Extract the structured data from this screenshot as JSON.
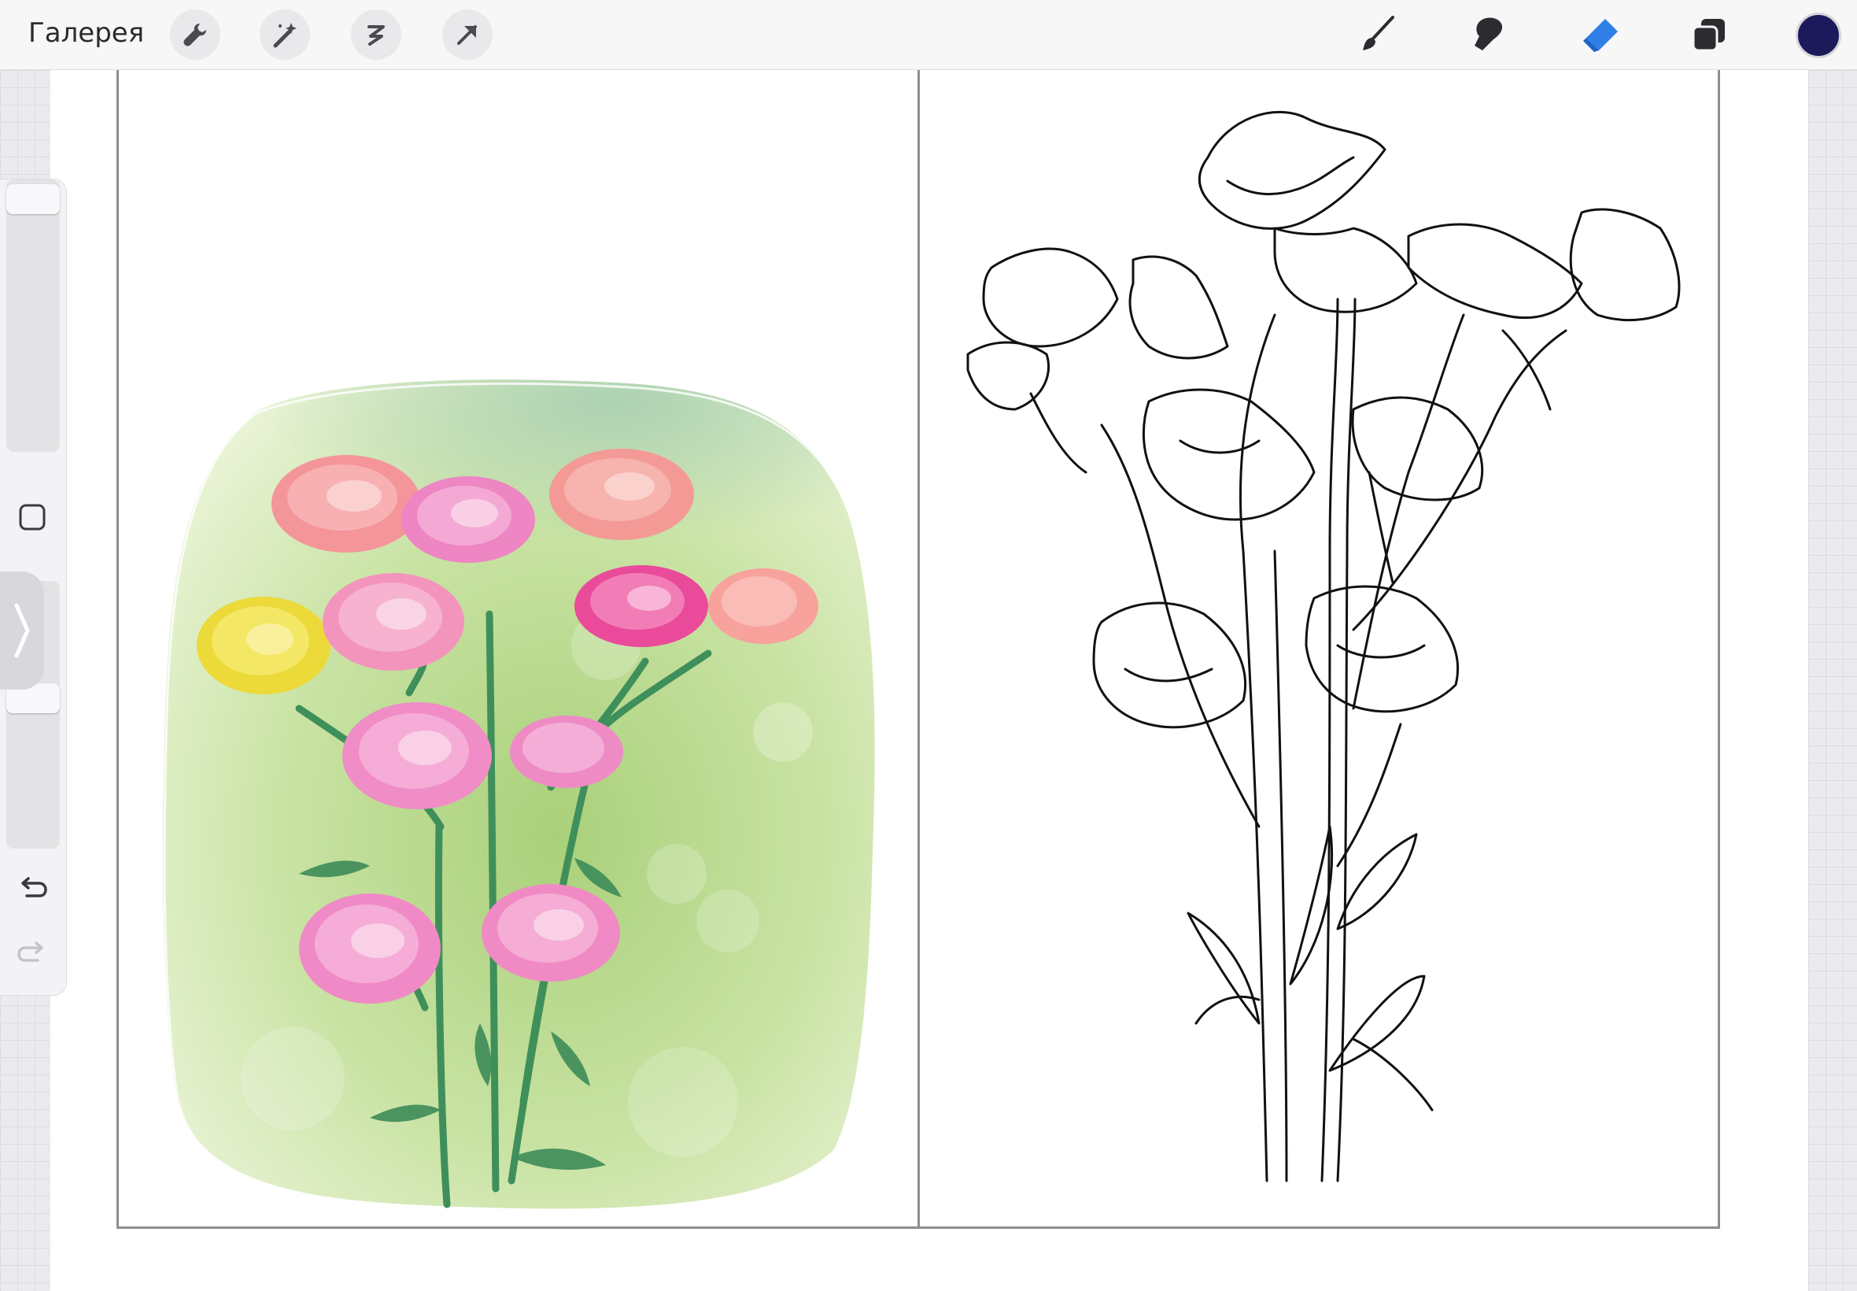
{
  "toolbar": {
    "gallery_label": "Галерея",
    "left_tools": [
      {
        "name": "wrench-icon"
      },
      {
        "name": "magic-wand-icon"
      },
      {
        "name": "selection-icon"
      },
      {
        "name": "transform-arrow-icon"
      }
    ],
    "right_tools": [
      {
        "name": "brush-icon"
      },
      {
        "name": "smudge-icon"
      },
      {
        "name": "eraser-icon",
        "active": true
      },
      {
        "name": "layers-icon"
      }
    ],
    "current_color": "#1c1a5a",
    "active_accent": "#2f7fe6"
  },
  "side_panel": {
    "icons": [
      "modify-square-icon",
      "panel-collapse-chevron-icon",
      "undo-icon",
      "redo-icon"
    ],
    "redo_enabled": false
  },
  "canvas": {
    "pages": [
      {
        "content": "watercolor-carnation-bouquet"
      },
      {
        "content": "carnation-line-art"
      }
    ]
  }
}
